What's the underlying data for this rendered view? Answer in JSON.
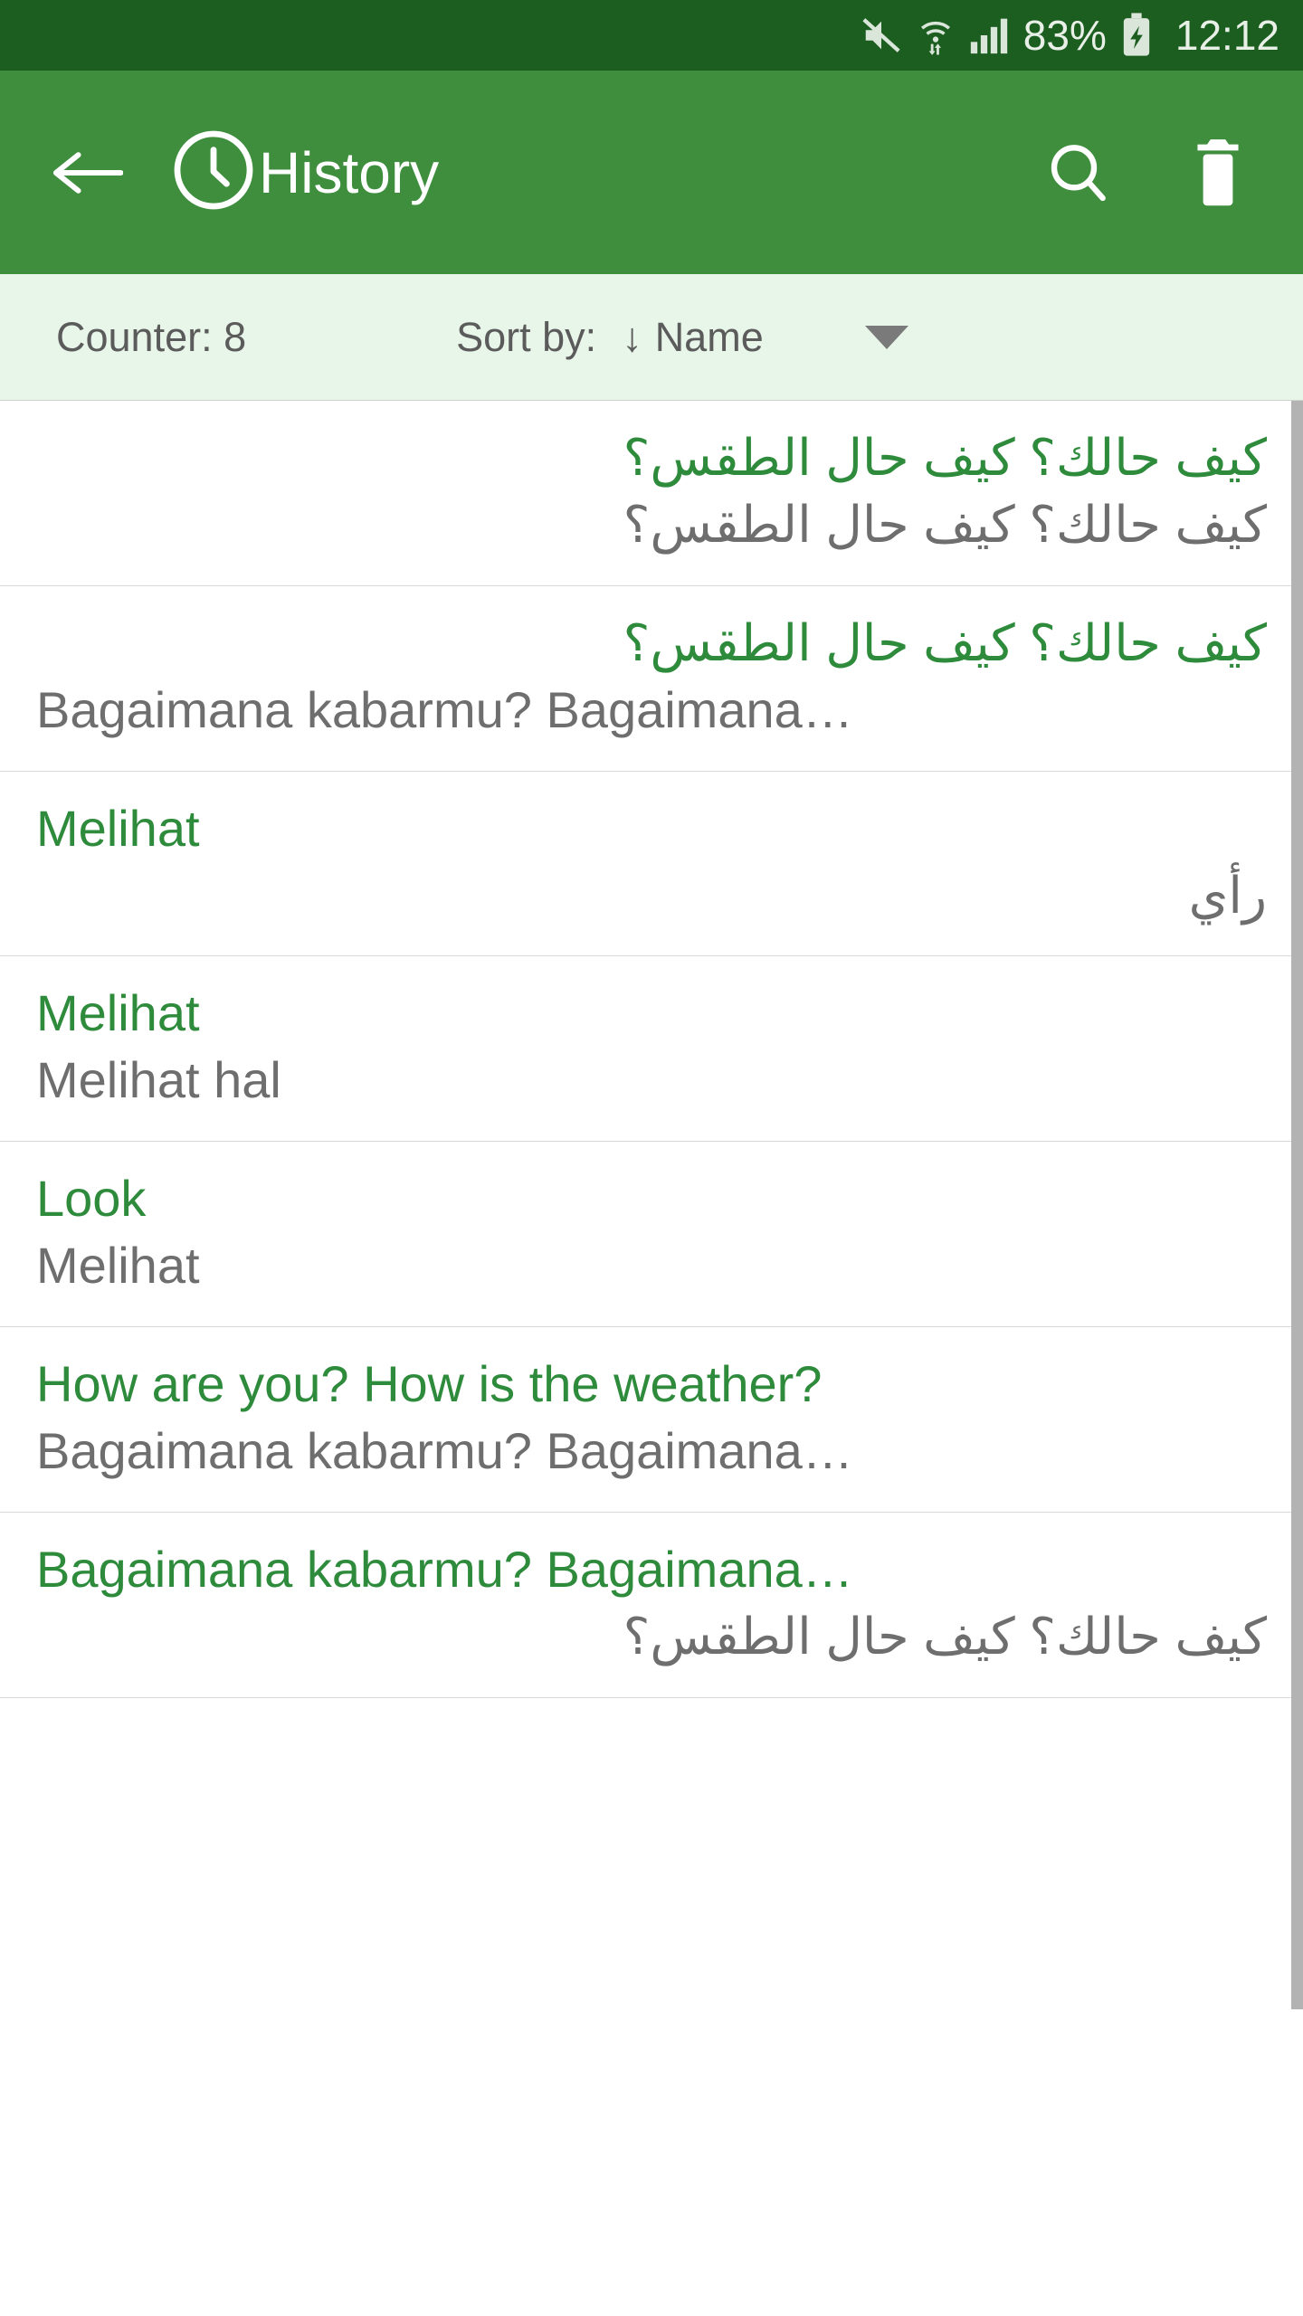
{
  "status_bar": {
    "battery_percent": "83%",
    "time": "12:12",
    "icons": [
      "mute-icon",
      "wifi-icon",
      "signal-icon",
      "battery-charging-icon"
    ],
    "background_color": "#1b5e20"
  },
  "app_bar": {
    "title": "History",
    "back_label": "back-arrow",
    "search_label": "search",
    "delete_label": "delete",
    "background_color": "#3e8e3e"
  },
  "sort_bar": {
    "counter_label": "Counter: 8",
    "sort_by_label": "Sort by:",
    "sort_direction": "↓",
    "sort_value": "Name",
    "background_color": "#e8f5e9"
  },
  "colors": {
    "primary_text": "#2e8b3c",
    "secondary_text": "#6e6e6e",
    "divider": "#d9d9d9",
    "scrollbar": "#b3b3b3"
  },
  "history_items": [
    {
      "primary": "كيف حالك؟ كيف حال الطقس؟",
      "primary_dir": "rtl",
      "secondary": "كيف حالك؟ كيف حال الطقس؟",
      "secondary_dir": "rtl"
    },
    {
      "primary": "كيف حالك؟ كيف حال الطقس؟",
      "primary_dir": "rtl",
      "secondary": "Bagaimana kabarmu? Bagaimana…",
      "secondary_dir": "ltr"
    },
    {
      "primary": "Melihat",
      "primary_dir": "ltr",
      "secondary": "رأي",
      "secondary_dir": "rtl"
    },
    {
      "primary": "Melihat",
      "primary_dir": "ltr",
      "secondary": "Melihat hal",
      "secondary_dir": "ltr"
    },
    {
      "primary": "Look",
      "primary_dir": "ltr",
      "secondary": "Melihat",
      "secondary_dir": "ltr"
    },
    {
      "primary": "How are you? How is the weather?",
      "primary_dir": "ltr",
      "secondary": "Bagaimana kabarmu? Bagaimana…",
      "secondary_dir": "ltr"
    },
    {
      "primary": "Bagaimana kabarmu? Bagaimana…",
      "primary_dir": "ltr",
      "secondary": "كيف حالك؟ كيف حال الطقس؟",
      "secondary_dir": "rtl"
    }
  ]
}
